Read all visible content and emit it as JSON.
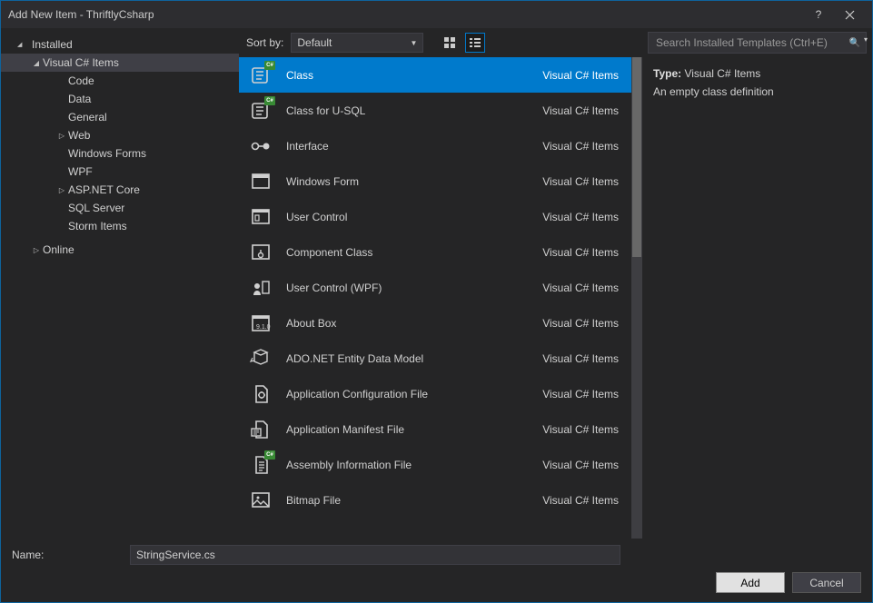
{
  "window": {
    "title": "Add New Item - ThriftlyCsharp"
  },
  "sidebar": {
    "header": "Installed",
    "nodes": [
      {
        "label": "Visual C# Items",
        "expanded": true,
        "selected": true,
        "children": [
          {
            "label": "Code"
          },
          {
            "label": "Data"
          },
          {
            "label": "General"
          },
          {
            "label": "Web",
            "hasChildren": true
          },
          {
            "label": "Windows Forms"
          },
          {
            "label": "WPF"
          },
          {
            "label": "ASP.NET Core",
            "hasChildren": true
          },
          {
            "label": "SQL Server"
          },
          {
            "label": "Storm Items"
          }
        ]
      },
      {
        "label": "Online",
        "hasChildren": true
      }
    ]
  },
  "toolbar": {
    "sort_label": "Sort by:",
    "sort_value": "Default"
  },
  "list": {
    "category_label": "Visual C# Items",
    "items": [
      {
        "name": "Class",
        "icon": "class",
        "selected": true,
        "badge": true
      },
      {
        "name": "Class for U-SQL",
        "icon": "class-usql",
        "badge": true
      },
      {
        "name": "Interface",
        "icon": "interface"
      },
      {
        "name": "Windows Form",
        "icon": "form"
      },
      {
        "name": "User Control",
        "icon": "usercontrol"
      },
      {
        "name": "Component Class",
        "icon": "component"
      },
      {
        "name": "User Control (WPF)",
        "icon": "usercontrol-wpf"
      },
      {
        "name": "About Box",
        "icon": "aboutbox"
      },
      {
        "name": "ADO.NET Entity Data Model",
        "icon": "ado"
      },
      {
        "name": "Application Configuration File",
        "icon": "config"
      },
      {
        "name": "Application Manifest File",
        "icon": "manifest"
      },
      {
        "name": "Assembly Information File",
        "icon": "assembly",
        "badge": true
      },
      {
        "name": "Bitmap File",
        "icon": "bitmap"
      }
    ]
  },
  "search": {
    "placeholder": "Search Installed Templates (Ctrl+E)"
  },
  "details": {
    "type_label": "Type:",
    "type_value": "Visual C# Items",
    "description": "An empty class definition"
  },
  "footer": {
    "name_label": "Name:",
    "name_value": "StringService.cs",
    "add_label": "Add",
    "cancel_label": "Cancel"
  }
}
